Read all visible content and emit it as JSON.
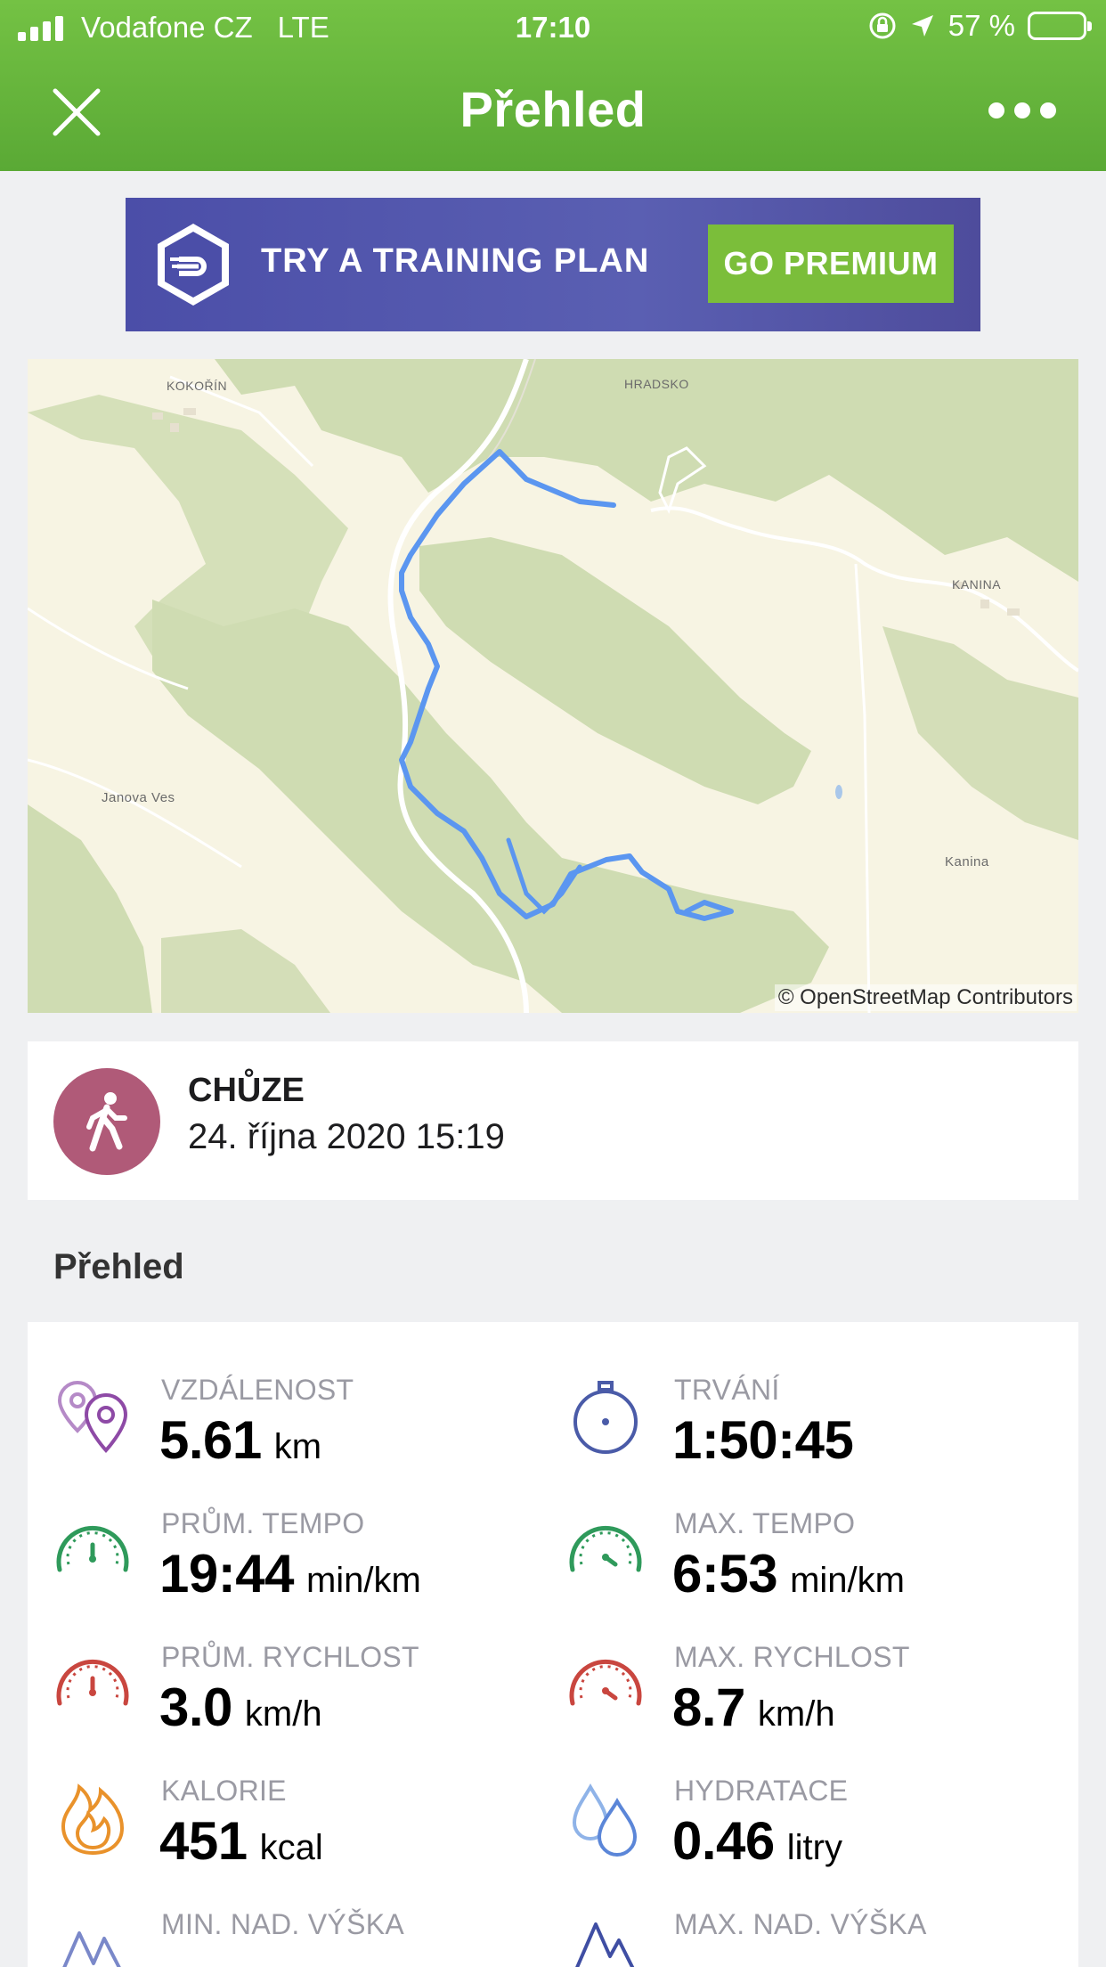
{
  "status_bar": {
    "carrier": "Vodafone CZ",
    "network": "LTE",
    "time": "17:10",
    "battery": "57 %",
    "battery_level": 0.57
  },
  "header": {
    "title": "Přehled",
    "close_icon": "close-icon",
    "more_icon": "more-icon"
  },
  "banner": {
    "text": "TRY A TRAINING PLAN",
    "button": "GO PREMIUM"
  },
  "map": {
    "labels": [
      "KOKOŘÍN",
      "HRADSKO",
      "KANINA",
      "Janova Ves",
      "Kanina"
    ],
    "attribution": "© OpenStreetMap Contributors",
    "route_color": "#5b96f0"
  },
  "activity": {
    "type": "CHŮZE",
    "datetime": "24. října 2020 15:19",
    "icon": "walking-icon"
  },
  "section": {
    "title": "Přehled"
  },
  "stats": [
    {
      "label": "VZDÁLENOST",
      "value": "5.61",
      "unit": "km",
      "icon": "distance-pin-icon"
    },
    {
      "label": "TRVÁNÍ",
      "value": "1:50:45",
      "unit": "",
      "icon": "stopwatch-icon"
    },
    {
      "label": "PRŮM. TEMPO",
      "value": "19:44",
      "unit": "min/km",
      "icon": "gauge-green-icon"
    },
    {
      "label": "MAX. TEMPO",
      "value": "6:53",
      "unit": "min/km",
      "icon": "gauge-green-max-icon"
    },
    {
      "label": "PRŮM. RYCHLOST",
      "value": "3.0",
      "unit": "km/h",
      "icon": "gauge-red-icon"
    },
    {
      "label": "MAX. RYCHLOST",
      "value": "8.7",
      "unit": "km/h",
      "icon": "gauge-red-max-icon"
    },
    {
      "label": "KALORIE",
      "value": "451",
      "unit": "kcal",
      "icon": "flame-icon"
    },
    {
      "label": "HYDRATACE",
      "value": "0.46",
      "unit": "litry",
      "icon": "water-drops-icon"
    },
    {
      "label": "MIN. NAD. VÝŠKA",
      "value": "",
      "unit": "",
      "icon": "mountain-low-icon"
    },
    {
      "label": "MAX. NAD. VÝŠKA",
      "value": "",
      "unit": "",
      "icon": "mountain-high-icon"
    }
  ],
  "colors": {
    "header_green": "#6ab93f",
    "banner_purple": "#5255aa",
    "premium_green": "#7bbe3a",
    "activity_avatar": "#b05a78"
  }
}
